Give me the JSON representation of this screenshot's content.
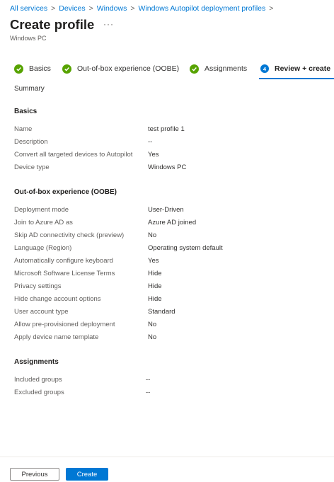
{
  "breadcrumb": [
    "All services",
    "Devices",
    "Windows",
    "Windows Autopilot deployment profiles"
  ],
  "header": {
    "title": "Create profile",
    "more": "···",
    "subtitle": "Windows PC"
  },
  "steps": [
    {
      "label": "Basics",
      "state": "done"
    },
    {
      "label": "Out-of-box experience (OOBE)",
      "state": "done"
    },
    {
      "label": "Assignments",
      "state": "done"
    },
    {
      "label": "Review + create",
      "state": "active",
      "number": "4"
    }
  ],
  "summary_label": "Summary",
  "sections": {
    "basics": {
      "heading": "Basics",
      "rows": [
        {
          "label": "Name",
          "value": "test profile 1"
        },
        {
          "label": "Description",
          "value": "--"
        },
        {
          "label": "Convert all targeted devices to Autopilot",
          "value": "Yes"
        },
        {
          "label": "Device type",
          "value": "Windows PC"
        }
      ]
    },
    "oobe": {
      "heading": "Out-of-box experience (OOBE)",
      "rows": [
        {
          "label": "Deployment mode",
          "value": "User-Driven"
        },
        {
          "label": "Join to Azure AD as",
          "value": "Azure AD joined"
        },
        {
          "label": "Skip AD connectivity check (preview)",
          "value": "No"
        },
        {
          "label": "Language (Region)",
          "value": "Operating system default"
        },
        {
          "label": "Automatically configure keyboard",
          "value": "Yes"
        },
        {
          "label": "Microsoft Software License Terms",
          "value": "Hide"
        },
        {
          "label": "Privacy settings",
          "value": "Hide"
        },
        {
          "label": "Hide change account options",
          "value": "Hide"
        },
        {
          "label": "User account type",
          "value": "Standard"
        },
        {
          "label": "Allow pre-provisioned deployment",
          "value": "No"
        },
        {
          "label": "Apply device name template",
          "value": "No"
        }
      ]
    },
    "assignments": {
      "heading": "Assignments",
      "rows": [
        {
          "label": "Included groups",
          "value": "--"
        },
        {
          "label": "Excluded groups",
          "value": "--"
        }
      ]
    }
  },
  "footer": {
    "previous_label": "Previous",
    "create_label": "Create"
  },
  "colors": {
    "accent": "#0078d4",
    "success": "#57a300"
  }
}
